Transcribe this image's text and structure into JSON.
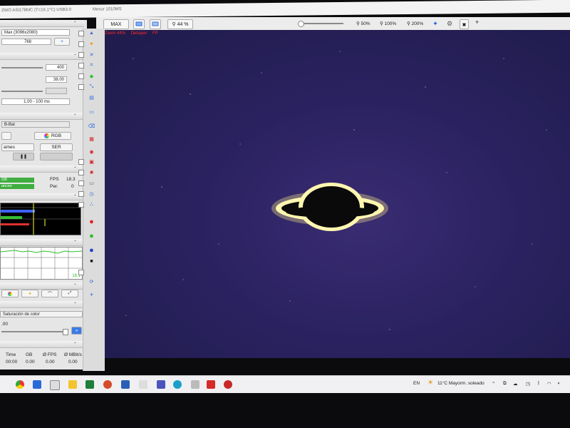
{
  "window": {
    "title": "ZWO ASI178MC (T=16.1°C) USB3.0",
    "status": "Mesur 1010MS"
  },
  "toolbar": {
    "max_label": "MAX",
    "zoom_value": "44 %",
    "zoom_50": "50%",
    "zoom_100": "100%",
    "zoom_200": "200%",
    "plus_label": "+"
  },
  "viewer": {
    "zoom_text": "Zoom 44%",
    "debayer_text": "Debayer",
    "fp_text": "FP"
  },
  "left_panel": {
    "resolution": "Max (3096x2080)",
    "line_value": "768",
    "gain_value": "400",
    "exposure_value": "38.00",
    "range_label": "1.00 - 100 ms",
    "mode_label": "B-Bal",
    "rgb_button": "RGB",
    "frames_label": "ames",
    "ser_button": "SER",
    "gb_label": "GB",
    "fps_label": "FPS",
    "fps_value": "18.3",
    "ances_label": "ances",
    "per_label": "Per.",
    "per_value": "0",
    "temp_value": "16.1",
    "saturation_label": "Saturación de color",
    "saturation_value": ".00",
    "stats": {
      "headers": [
        "Time",
        "GB",
        "Ø FPS",
        "Ø MBit/s"
      ],
      "values": [
        "00:00",
        "0.00",
        "0.00",
        "0.00"
      ]
    }
  },
  "taskbar": {
    "lang": "EN",
    "weather": "11°C  Mayorm. soleado"
  },
  "colors": {
    "viewer_bg": "#2a2260",
    "planet_glow": "#fff2a0",
    "red_label": "#ff2b2b"
  }
}
